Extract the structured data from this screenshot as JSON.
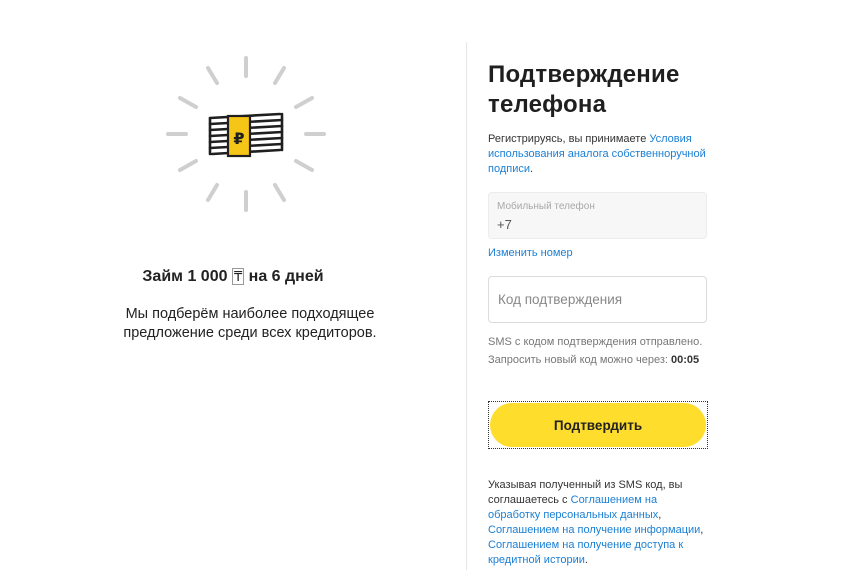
{
  "left": {
    "loan_title_prefix": "Займ 1 000 ",
    "loan_title_currency": "₸",
    "loan_title_suffix": " на 6 дней",
    "description": "Мы подберём наиболее подходящее предложение среди всех кредиторов.",
    "illustration_icon": "money-stack-ruble-icon",
    "currency_symbol": "₽"
  },
  "right": {
    "title": "Подтверждение телефона",
    "terms_prefix": "Регистрируясь, вы принимаете ",
    "terms_link": "Условия использования аналога собственноручной подписи",
    "terms_suffix": ".",
    "phone_label": "Мобильный телефон",
    "phone_value": "+7",
    "change_number": "Изменить номер",
    "code_placeholder": "Код подтверждения",
    "sms_sent": "SMS с кодом подтверждения отправлено.",
    "resend_prefix": "Запросить новый код можно через:",
    "resend_timer": "00:05",
    "confirm_button": "Подтвердить",
    "agree_prefix": "Указывая полученный из SMS код, вы соглашаетесь с ",
    "agree_link_1": "Соглашением на обработку персональных данных",
    "agree_sep_1": ", ",
    "agree_link_2": "Соглашением на получение информации",
    "agree_sep_2": ", ",
    "agree_link_3": "Соглашением на получение доступа к кредитной истории",
    "agree_suffix": "."
  },
  "colors": {
    "accent": "#ffdd2d",
    "link": "#1a7fd4",
    "ray": "#cfcfcf",
    "money": "#f5c518",
    "ink": "#1f1f1f"
  }
}
